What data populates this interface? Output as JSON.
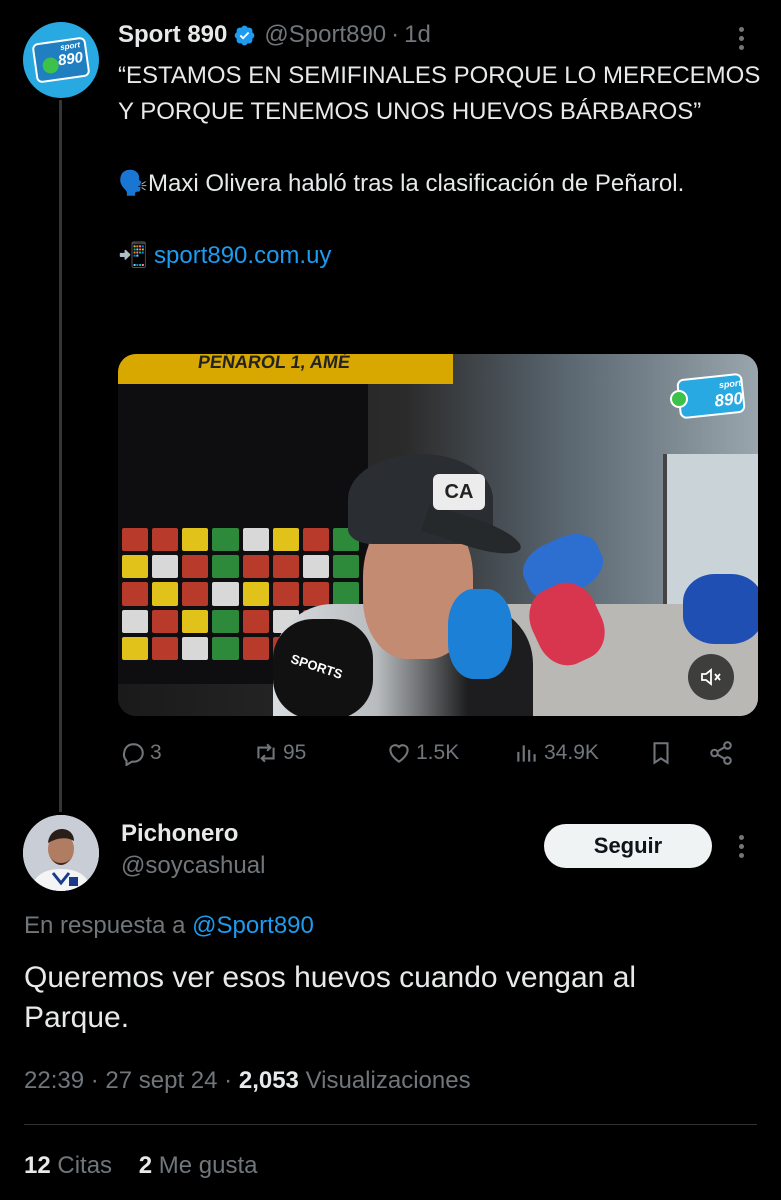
{
  "tweet": {
    "author_name": "Sport 890",
    "handle": "@Sport890",
    "separator": "·",
    "time": "1d",
    "quote_line": "“ESTAMOS EN SEMIFINALES PORQUE LO MERECEMOS Y PORQUE TENEMOS UNOS HUEVOS BÁRBAROS”",
    "speaking_emoji": "🗣️",
    "line2": "Maxi Olivera habló tras la clasificación de Peñarol.",
    "phone_emoji": "📲",
    "link": "sport890.com.uy",
    "avatar_logo_text": "890",
    "avatar_logo_small": "sport",
    "media": {
      "sign_text": "PEÑAROL 1, AMÉ",
      "cap_text": "CA",
      "mic_text": "SPORTS",
      "watermark_text": "890",
      "watermark_small": "sport"
    },
    "actions": {
      "replies": "3",
      "reposts": "95",
      "likes": "1.5K",
      "views": "34.9K"
    }
  },
  "reply": {
    "author_name": "Pichonero",
    "handle": "@soycashual",
    "follow_label": "Seguir",
    "replying_prefix": "En respuesta a",
    "replying_to": "@Sport890",
    "text": "Queremos ver esos huevos cuando vengan al Parque.",
    "time": "22:39",
    "sep": "·",
    "date": "27 sept 24",
    "views_count": "2,053",
    "views_label": "Visualizaciones",
    "quotes_count": "12",
    "quotes_label": "Citas",
    "likes_count": "2",
    "likes_label": "Me gusta"
  },
  "colors": {
    "background": "#000000",
    "text": "#e7e9ea",
    "muted": "#71767b",
    "link": "#1d9bf0",
    "verified": "#1d9bf0",
    "follow_bg": "#eff3f4"
  }
}
